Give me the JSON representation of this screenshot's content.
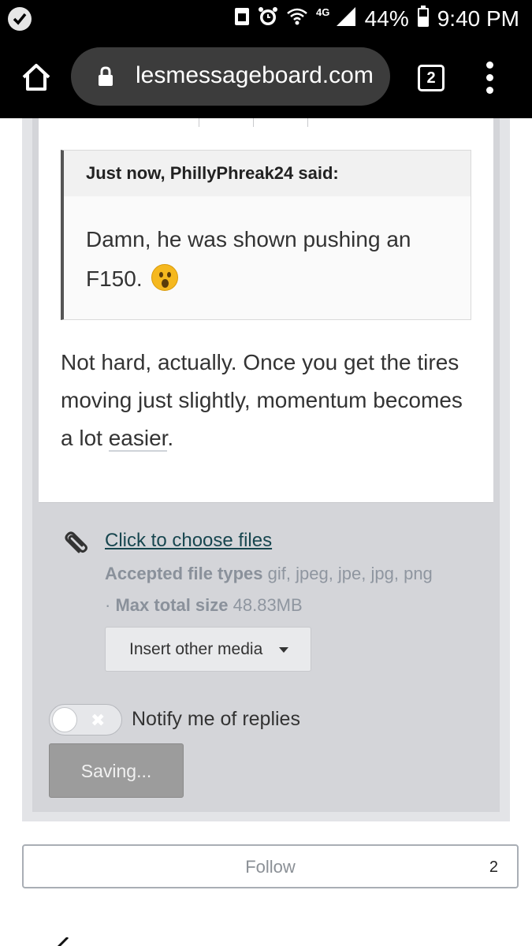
{
  "status_bar": {
    "battery_percent": "44%",
    "time": "9:40 PM",
    "network": "4G",
    "icons": [
      "app-check-icon",
      "sim-icon",
      "alarm-icon",
      "wifi-icon",
      "signal-icon",
      "battery-icon"
    ]
  },
  "browser": {
    "url": "lesmessageboard.com",
    "tab_count": "2",
    "icons": [
      "home-icon",
      "lock-icon",
      "tabs-icon",
      "overflow-menu-icon"
    ]
  },
  "quote": {
    "author_line": "Just now, PhillyPhreak24 said:",
    "body": "Damn, he was shown pushing an F150.",
    "emoji": "astonished-face-icon"
  },
  "reply": {
    "text_before": "Not hard, actually. Once you get the tires moving just slightly, momentum becomes a lot ",
    "text_underlined": "easier",
    "text_after": "."
  },
  "attachments": {
    "choose_files_label": "Click to choose files",
    "accepted_label": "Accepted file types",
    "accepted_value": "gif, jpeg, jpe, jpg, png",
    "separator": "·",
    "max_label": "Max total size",
    "max_value": "48.83MB",
    "insert_media_label": "Insert other media",
    "icons": [
      "paperclip-icon",
      "caret-down-icon"
    ]
  },
  "notify": {
    "label": "Notify me of replies",
    "toggle_on": false,
    "toggle_mark": "✖"
  },
  "submit": {
    "label": "Saving..."
  },
  "follow": {
    "label": "Follow",
    "count": "2"
  },
  "colors": {
    "link": "#17464f",
    "panel_outer": "#e3e4e7",
    "panel_inner": "#d4d5d9",
    "button_disabled": "#9c9c9c",
    "emoji_yellow": "#f5b81f"
  }
}
